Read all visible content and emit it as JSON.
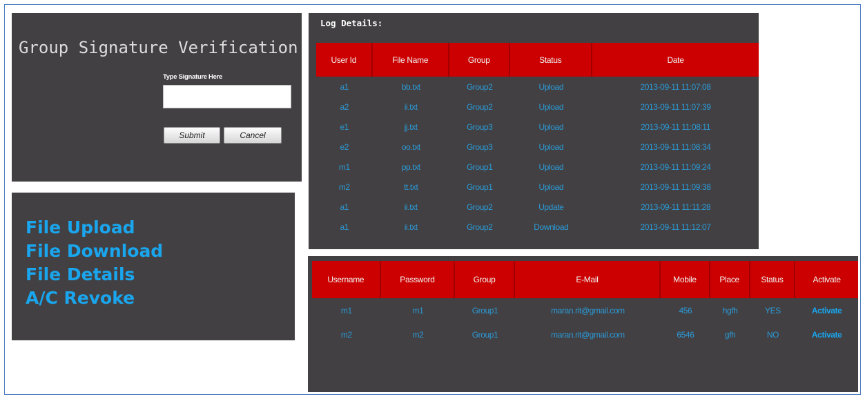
{
  "signature": {
    "title": "Group Signature Verification :",
    "label": "Type Signature Here",
    "input_value": "",
    "submit_label": "Submit",
    "cancel_label": "Cancel"
  },
  "menu": {
    "items": [
      "File Upload",
      "File Download",
      "File Details",
      "A/C Revoke"
    ]
  },
  "log": {
    "heading": "Log Details:",
    "columns": [
      "User Id",
      "File Name",
      "Group",
      "Status",
      "Date"
    ],
    "rows": [
      [
        "a1",
        "bb.txt",
        "Group2",
        "Upload",
        "2013-09-11 11:07:08"
      ],
      [
        "a2",
        "ii.txt",
        "Group2",
        "Upload",
        "2013-09-11 11:07:39"
      ],
      [
        "e1",
        "jj.txt",
        "Group3",
        "Upload",
        "2013-09-11 11:08:11"
      ],
      [
        "e2",
        "oo.txt",
        "Group3",
        "Upload",
        "2013-09-11 11:08:34"
      ],
      [
        "m1",
        "pp.txt",
        "Group1",
        "Upload",
        "2013-09-11 11:09:24"
      ],
      [
        "m2",
        "tt.txt",
        "Group1",
        "Upload",
        "2013-09-11 11:09:38"
      ],
      [
        "a1",
        "ii.txt",
        "Group2",
        "Update",
        "2013-09-11 11:11:28"
      ],
      [
        "a1",
        "ii.txt",
        "Group2",
        "Download",
        "2013-09-11 11:12:07"
      ]
    ]
  },
  "users": {
    "columns": [
      "Username",
      "Password",
      "Group",
      "E-Mail",
      "Mobile",
      "Place",
      "Status",
      "Activate"
    ],
    "rows": [
      [
        "m1",
        "m1",
        "Group1",
        "maran.rit@gmail.com",
        "456",
        "hgfh",
        "YES",
        "Activate"
      ],
      [
        "m2",
        "m2",
        "Group1",
        "maran.rit@gmail.com",
        "6546",
        "gfh",
        "NO",
        "Activate"
      ]
    ]
  },
  "colors": {
    "panel_bg": "#424042",
    "header_red": "#cc0000",
    "cell_text": "#2b9ad8",
    "menu_text": "#1aa6ee",
    "frame_border": "#4f7fbf"
  }
}
